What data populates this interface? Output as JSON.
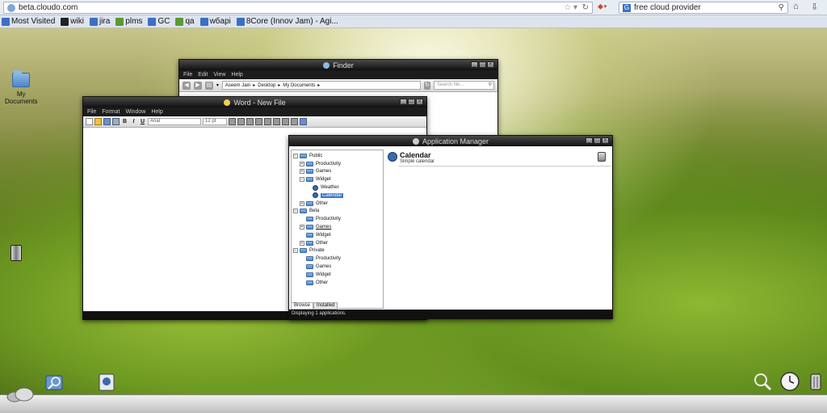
{
  "browser": {
    "url": "beta.cloudo.com",
    "search_engine": "G",
    "search_query": "free cloud provider",
    "bookmarks": [
      {
        "label": "Most Visited",
        "color": "#3c6fc4"
      },
      {
        "label": "wiki",
        "color": "#222"
      },
      {
        "label": "jira",
        "color": "#3c6fc4"
      },
      {
        "label": "plms",
        "color": "#5a9a34"
      },
      {
        "label": "GC",
        "color": "#3c6fc4"
      },
      {
        "label": "qa",
        "color": "#5a9a34"
      },
      {
        "label": "wбapi",
        "color": "#3c6fc4"
      },
      {
        "label": "8Core (Innov Jam) - Agi...",
        "color": "#3c6fc4"
      }
    ]
  },
  "desktop": {
    "icons": [
      {
        "label": "My\nDocuments",
        "icon": "folder-icon"
      }
    ]
  },
  "finder": {
    "title": "Finder",
    "menu": [
      "File",
      "Edit",
      "View",
      "Help"
    ],
    "breadcrumb": [
      "Aseem Jain",
      "Desktop",
      "My Documents"
    ],
    "search_placeholder": "Search file..."
  },
  "word": {
    "title": "Word - New File",
    "menu": [
      "File",
      "Format",
      "Window",
      "Help"
    ],
    "font": "Arial",
    "size": "12 pt"
  },
  "appmgr": {
    "title": "Application Manager",
    "tree": [
      {
        "label": "Public",
        "level": 0,
        "exp": "−",
        "type": "folder"
      },
      {
        "label": "Productivity",
        "level": 1,
        "exp": "+",
        "type": "folder"
      },
      {
        "label": "Games",
        "level": 1,
        "exp": "+",
        "type": "folder"
      },
      {
        "label": "Widget",
        "level": 1,
        "exp": "−",
        "type": "folder"
      },
      {
        "label": "Weather",
        "level": 2,
        "exp": "",
        "type": "app"
      },
      {
        "label": "Calendar",
        "level": 2,
        "exp": "",
        "type": "app",
        "selected": true
      },
      {
        "label": "Other",
        "level": 1,
        "exp": "+",
        "type": "folder"
      },
      {
        "label": "Beta",
        "level": 0,
        "exp": "−",
        "type": "folder"
      },
      {
        "label": "Productivity",
        "level": 1,
        "exp": "",
        "type": "folder"
      },
      {
        "label": "Games",
        "level": 1,
        "exp": "+",
        "type": "folder",
        "underline": true
      },
      {
        "label": "Widget",
        "level": 1,
        "exp": "",
        "type": "folder"
      },
      {
        "label": "Other",
        "level": 1,
        "exp": "+",
        "type": "folder"
      },
      {
        "label": "Private",
        "level": 0,
        "exp": "−",
        "type": "folder"
      },
      {
        "label": "Productivity",
        "level": 1,
        "exp": "",
        "type": "folder"
      },
      {
        "label": "Games",
        "level": 1,
        "exp": "",
        "type": "folder"
      },
      {
        "label": "Widget",
        "level": 1,
        "exp": "",
        "type": "folder"
      },
      {
        "label": "Other",
        "level": 1,
        "exp": "",
        "type": "folder"
      }
    ],
    "tabs": [
      "Browse",
      "Installed"
    ],
    "detail_title": "Calendar",
    "detail_subtitle": "Simple calendar",
    "status": "Displaying 1 applications."
  }
}
